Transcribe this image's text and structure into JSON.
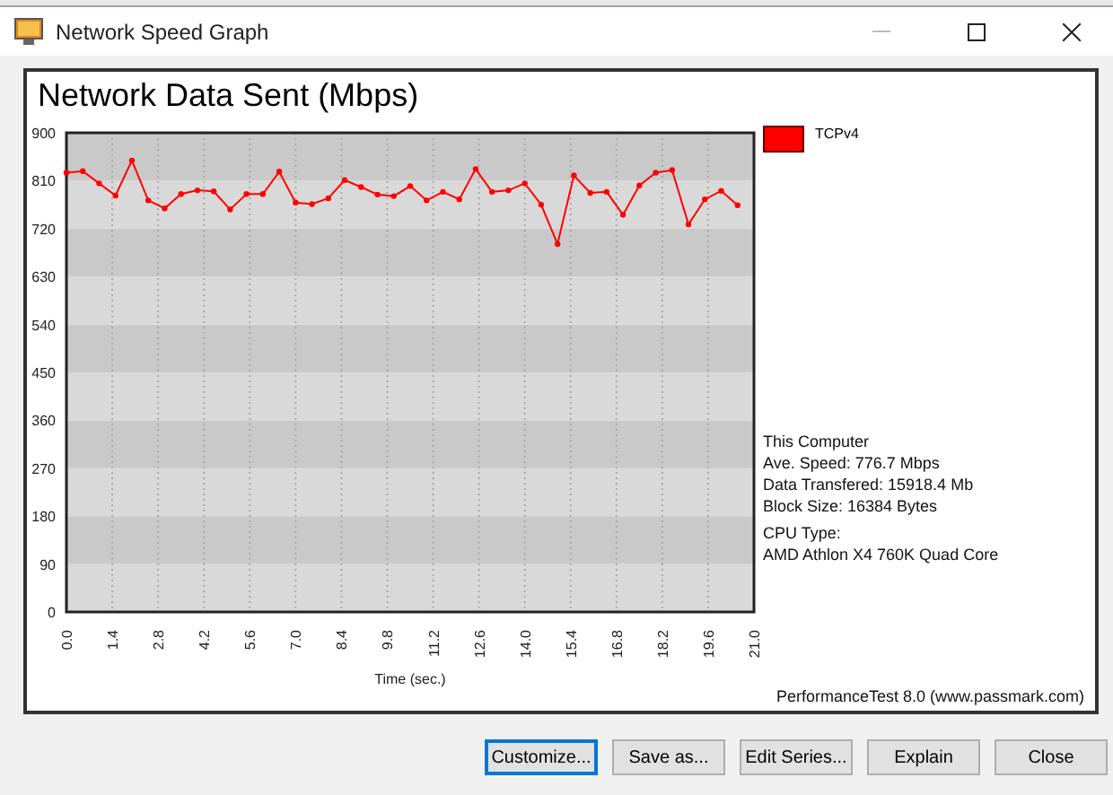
{
  "window": {
    "title": "Network Speed Graph"
  },
  "chart": {
    "chart_data": {
      "type": "line",
      "title": "Network Data Sent (Mbps)",
      "xlabel": "Time (sec.)",
      "x": [
        0,
        0.5,
        1,
        1.5,
        2,
        2.5,
        3,
        3.5,
        4,
        4.5,
        5,
        5.5,
        6,
        6.5,
        7,
        7.5,
        8,
        8.5,
        9,
        9.5,
        10,
        10.5,
        11,
        11.5,
        12,
        12.5,
        13,
        13.5,
        14,
        14.5,
        15,
        15.5,
        16,
        16.5,
        17,
        17.5,
        18,
        18.5,
        19,
        19.5,
        20,
        20.5
      ],
      "grid": true,
      "series": [
        {
          "name": "TCPv4",
          "color": "#ff0000",
          "marker": "circle",
          "values": [
            825,
            828,
            805,
            782,
            848,
            773,
            758,
            785,
            792,
            790,
            756,
            785,
            785,
            827,
            769,
            766,
            777,
            811,
            798,
            784,
            781,
            800,
            773,
            789,
            775,
            832,
            789,
            792,
            805,
            765,
            691,
            820,
            787,
            789,
            746,
            801,
            825,
            830,
            728,
            775,
            791,
            764
          ]
        }
      ],
      "xlim": [
        0,
        21
      ],
      "ylim": [
        0,
        900
      ],
      "xticks": [
        {
          "value": 0,
          "label": "0.0"
        },
        {
          "value": 1.4,
          "label": "1.4"
        },
        {
          "value": 2.8,
          "label": "2.8"
        },
        {
          "value": 4.2,
          "label": "4.2"
        },
        {
          "value": 5.6,
          "label": "5.6"
        },
        {
          "value": 7,
          "label": "7.0"
        },
        {
          "value": 8.4,
          "label": "8.4"
        },
        {
          "value": 9.8,
          "label": "9.8"
        },
        {
          "value": 11.2,
          "label": "11.2"
        },
        {
          "value": 12.6,
          "label": "12.6"
        },
        {
          "value": 14,
          "label": "14.0"
        },
        {
          "value": 15.4,
          "label": "15.4"
        },
        {
          "value": 16.8,
          "label": "16.8"
        },
        {
          "value": 18.2,
          "label": "18.2"
        },
        {
          "value": 19.6,
          "label": "19.6"
        },
        {
          "value": 21,
          "label": "21.0"
        }
      ],
      "yticks": [
        0,
        90,
        180,
        270,
        360,
        450,
        540,
        630,
        720,
        810,
        900
      ]
    },
    "info": [
      "This Computer",
      "Ave. Speed: 776.7 Mbps",
      "Data Transfered: 15918.4 Mb",
      "Block Size: 16384 Bytes",
      "CPU Type:",
      "AMD Athlon X4 760K Quad Core"
    ],
    "credit": "PerformanceTest 8.0 (www.passmark.com)"
  },
  "buttons": [
    {
      "label": "Customize...",
      "focused": true
    },
    {
      "label": "Save as...",
      "focused": false
    },
    {
      "label": "Edit Series...",
      "focused": false
    },
    {
      "label": "Explain",
      "focused": false
    },
    {
      "label": "Close",
      "focused": false
    }
  ]
}
